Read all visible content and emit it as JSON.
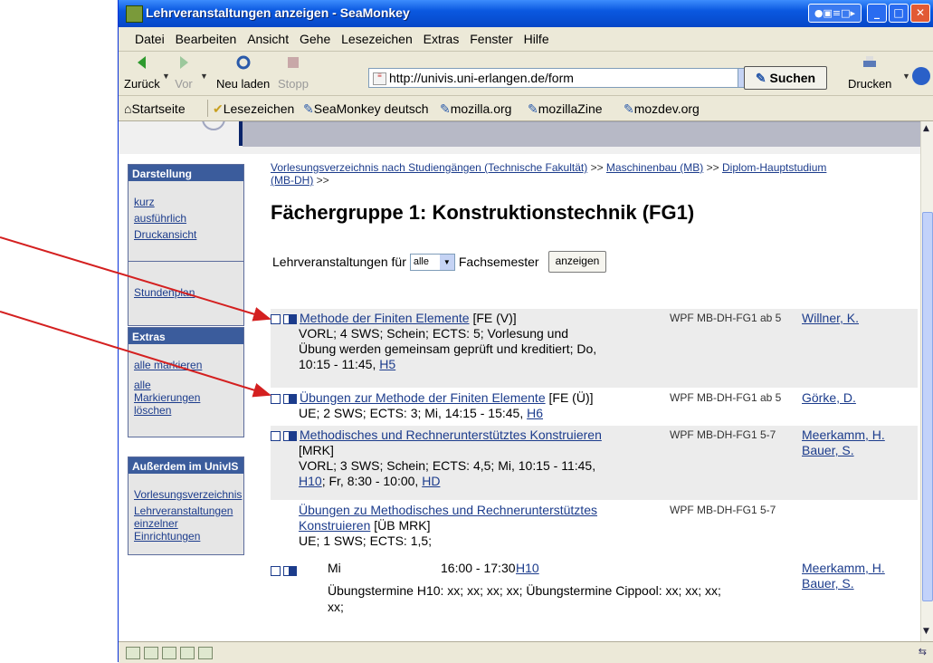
{
  "window": {
    "title": "Lehrveranstaltungen anzeigen - SeaMonkey",
    "tray_label": "●▣≡□▸"
  },
  "menu": [
    "Datei",
    "Bearbeiten",
    "Ansicht",
    "Gehe",
    "Lesezeichen",
    "Extras",
    "Fenster",
    "Hilfe"
  ],
  "nav": {
    "back": "Zurück",
    "forward": "Vor",
    "reload": "Neu laden",
    "stop": "Stopp",
    "url": "http://univis.uni-erlangen.de/form",
    "search": "Suchen",
    "print": "Drucken"
  },
  "bookmarks": [
    "Startseite",
    "Lesezeichen",
    "SeaMonkey deutsch",
    "mozilla.org",
    "mozillaZine",
    "mozdev.org"
  ],
  "sidebar": {
    "darstellung": {
      "title": "Darstellung",
      "kurz": "kurz",
      "ausfuehrlich": "ausführlich",
      "druck": "Druckansicht",
      "stundenplan": "Stundenplan"
    },
    "extras": {
      "title": "Extras",
      "markieren": "alle markieren",
      "loeschen1": "alle",
      "loeschen2": "Markierungen",
      "loeschen3": "löschen"
    },
    "ausserdem": {
      "title": "Außerdem im UnivIS",
      "vv": "Vorlesungsverzeichnis",
      "lv1": "Lehrveranstaltungen",
      "lv2": "einzelner",
      "lv3": "Einrichtungen"
    }
  },
  "breadcrumb": {
    "part1": "Vorlesungsverzeichnis nach Studiengängen (Technische Fakultät)",
    "sep": ">>",
    "part2": "Maschinenbau (MB)",
    "part3": "Diplom-Hauptstudium",
    "part4": "(MB-DH)"
  },
  "page_title": "Fächergruppe 1: Konstruktionstechnik (FG1)",
  "filter": {
    "label_pre": "Lehrveranstaltungen für",
    "select_value": "alle",
    "label_post": "Fachsemester",
    "button": "anzeigen"
  },
  "courses": [
    {
      "title": "Methode der Finiten Elemente",
      "code": "[FE (V)]",
      "l1": "VORL; 4 SWS; Schein; ECTS: 5; Vorlesung und",
      "l2": "Übung werden gemeinsam geprüft und kreditiert; Do,",
      "l3": "10:15 - 11:45,",
      "room": "H5",
      "wpf": "WPF MB-DH-FG1 ab 5",
      "lecturer": "Willner, K."
    },
    {
      "title": "Übungen zur Methode der Finiten Elemente",
      "code": "[FE (Ü)]",
      "l1": "UE; 2 SWS; ECTS: 3; Mi, 14:15 - 15:45,",
      "room": "H6",
      "wpf": "WPF MB-DH-FG1 ab 5",
      "lecturer": "Görke, D."
    },
    {
      "title": "Methodisches und Rechnerunterstütztes Konstruieren",
      "code": "[MRK]",
      "l1": "VORL; 3 SWS; Schein; ECTS: 4,5; Mi, 10:15 - 11:45,",
      "room": "H10",
      "l2": "; Fr, 8:30 - 10:00,",
      "room2": "HD",
      "wpf": "WPF MB-DH-FG1 5-7",
      "lecturer": "Meerkamm, H.",
      "lecturer2": "Bauer, S."
    },
    {
      "title1": "Übungen zu Methodisches und Rechnerunterstütztes",
      "title2": "Konstruieren",
      "code": "[ÜB MRK]",
      "l1": "UE; 1 SWS; ECTS: 1,5;",
      "wpf": "WPF MB-DH-FG1 5-7",
      "term_day": "Mi",
      "term_time": "16:00 - 17:30",
      "term_room": "H10",
      "term_note1": "Übungstermine H10: xx; xx; xx; xx; Übungstermine Cippool: xx; xx; xx;",
      "term_note2": "xx;",
      "lecturer": "Meerkamm, H.",
      "lecturer2": "Bauer, S."
    }
  ],
  "colors": {
    "annotation_arrow": "#d42020",
    "titlebar": "#0a58e0",
    "link": "#1c3c8c",
    "sidebar_header": "#3b5c9c"
  }
}
